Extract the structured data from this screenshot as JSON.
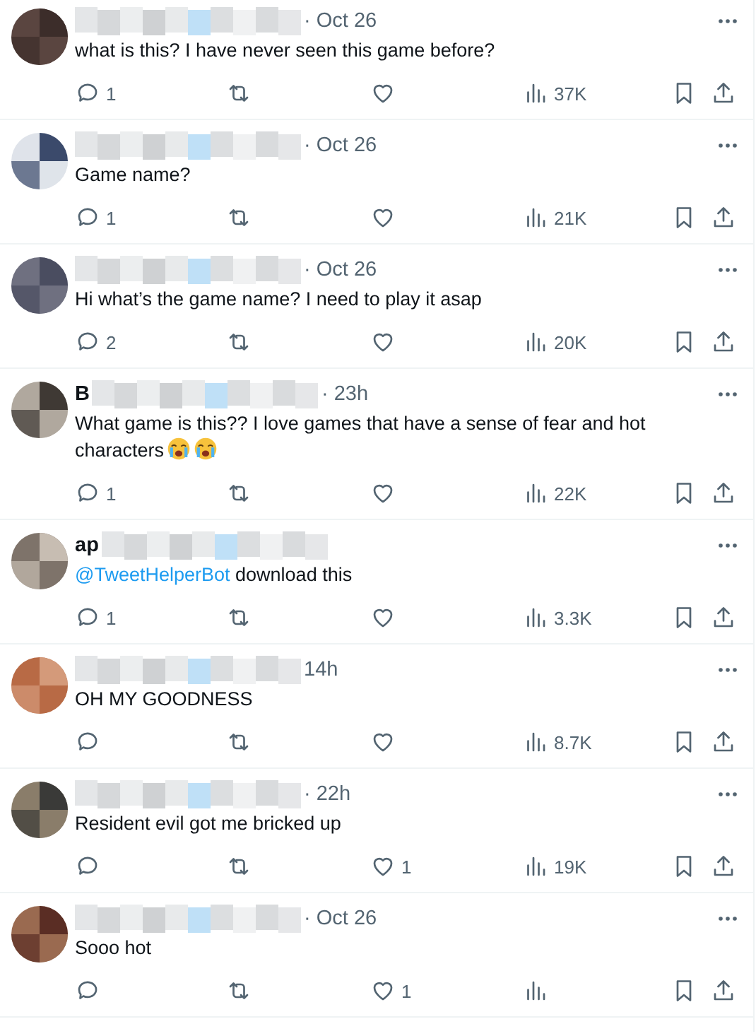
{
  "replies": [
    {
      "time": "· Oct 26",
      "segments": [
        {
          "kind": "text",
          "text": "what is this? I have never seen this game before?"
        }
      ],
      "reply_count": "1",
      "views": "37K"
    },
    {
      "time": "· Oct 26",
      "segments": [
        {
          "kind": "text",
          "text": "Game name?"
        }
      ],
      "reply_count": "1",
      "views": "21K"
    },
    {
      "time": "· Oct 26",
      "segments": [
        {
          "kind": "text",
          "text": "Hi what’s the game name? I need to play it asap"
        }
      ],
      "reply_count": "2",
      "views": "20K"
    },
    {
      "name_start": "B",
      "time": "· 23h",
      "segments": [
        {
          "kind": "text",
          "text": "What game is this?? I love games that have a sense of fear and hot characters"
        },
        {
          "kind": "emoji"
        },
        {
          "kind": "emoji"
        }
      ],
      "reply_count": "1",
      "views": "22K"
    },
    {
      "name_start": "ap",
      "segments": [
        {
          "kind": "mention",
          "text": "@TweetHelperBot"
        },
        {
          "kind": "text",
          "text": "download this"
        }
      ],
      "reply_count": "1",
      "views": "3.3K"
    },
    {
      "time": "14h",
      "segments": [
        {
          "kind": "text",
          "text": "OH MY GOODNESS"
        }
      ],
      "views": "8.7K"
    },
    {
      "time": "· 22h",
      "segments": [
        {
          "kind": "text",
          "text": "Resident evil got me bricked up"
        }
      ],
      "like_count": "1",
      "views": "19K"
    },
    {
      "time": "· Oct 26",
      "segments": [
        {
          "kind": "text",
          "text": "Sooo hot"
        }
      ],
      "like_count": "1"
    }
  ]
}
